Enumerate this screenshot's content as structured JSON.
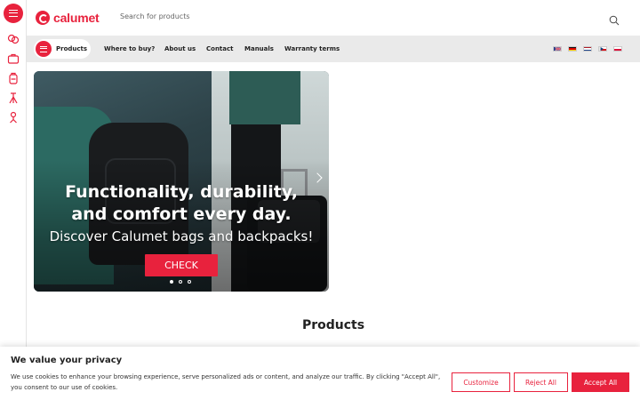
{
  "brand": {
    "name": "calumet",
    "accent": "#e8223d"
  },
  "rail": {
    "menu_icon": "hamburger-icon",
    "items": [
      {
        "icon": "camera-link-icon"
      },
      {
        "icon": "briefcase-icon"
      },
      {
        "icon": "backpack-icon"
      },
      {
        "icon": "tripod-icon"
      },
      {
        "icon": "light-stand-icon"
      }
    ]
  },
  "header": {
    "search_placeholder": "Search for products",
    "search_icon": "search-icon"
  },
  "nav": {
    "products_label": "Products",
    "links": [
      "Where to buy?",
      "About us",
      "Contact",
      "Manuals",
      "Warranty terms"
    ],
    "languages": [
      "English",
      "German",
      "Dutch",
      "Czech",
      "Polish"
    ]
  },
  "hero": {
    "headline_1": "Functionality, durability,",
    "headline_2": "and comfort every day.",
    "subline": "Discover Calumet bags and backpacks!",
    "cta": "CHECK",
    "slides_total": 3,
    "active_slide": 1
  },
  "section": {
    "title": "Products"
  },
  "cookie": {
    "title": "We value your privacy",
    "text": "We use cookies to enhance your browsing experience, serve personalized ads or content, and analyze our traffic. By clicking \"Accept All\", you consent to our use of cookies.",
    "customize": "Customize",
    "reject": "Reject All",
    "accept": "Accept All"
  }
}
